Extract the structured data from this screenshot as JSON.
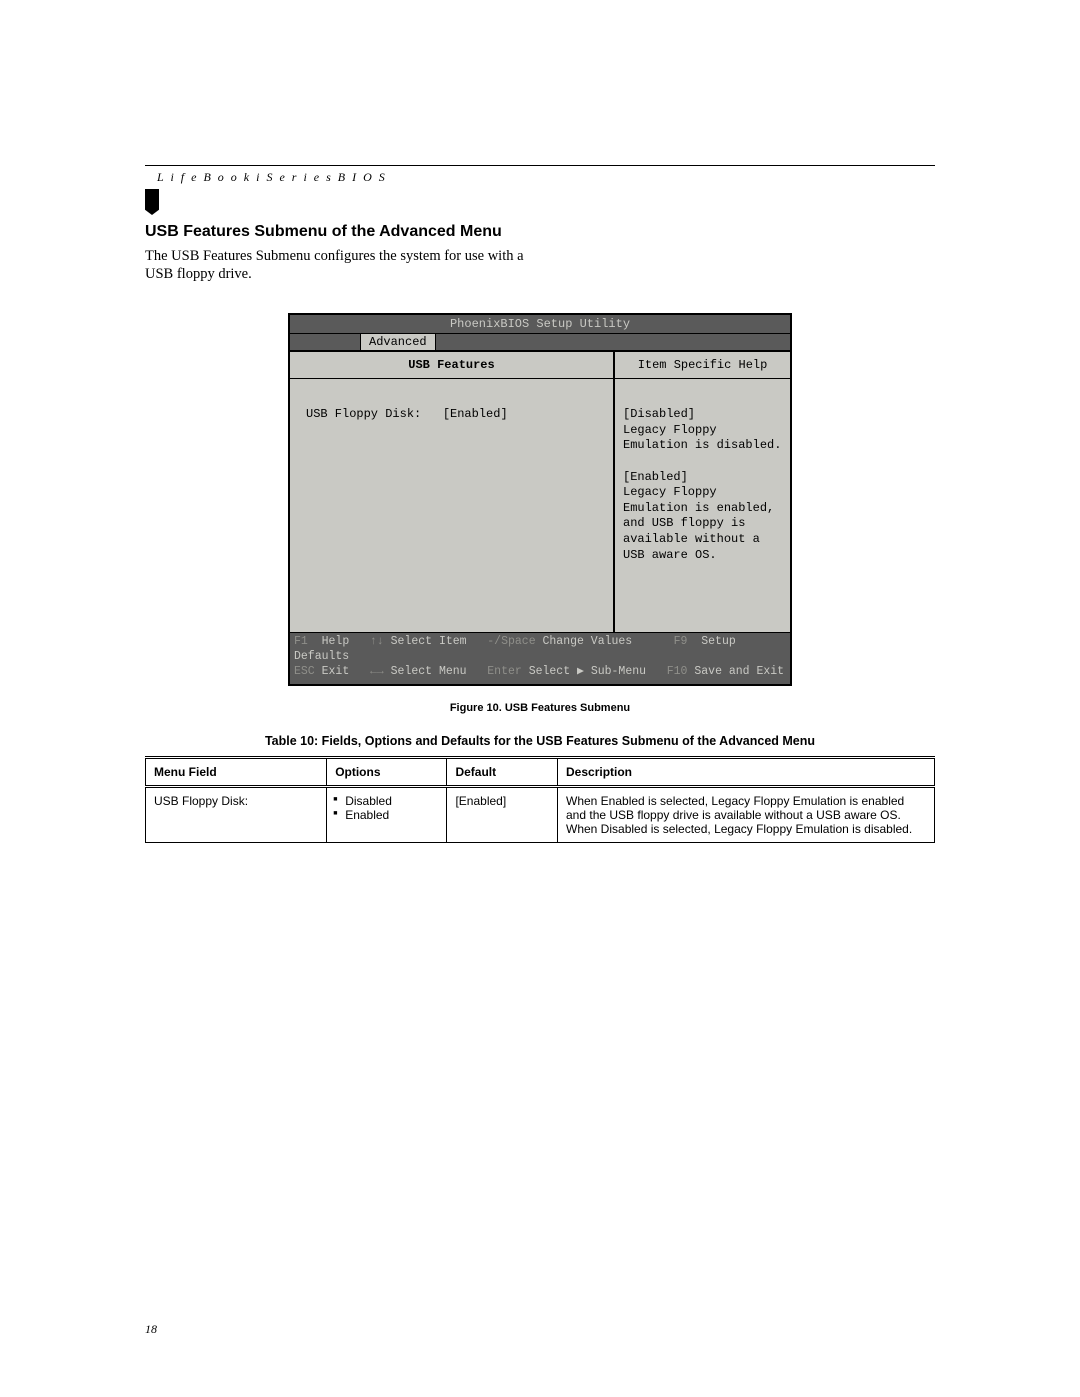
{
  "header": {
    "running": "L i f e B o o k   i   S e r i e s   B I O S"
  },
  "section": {
    "title": "USB Features Submenu of the Advanced Menu",
    "intro": "The USB Features Submenu configures the system for use with a USB floppy drive."
  },
  "bios": {
    "title": "PhoenixBIOS Setup Utility",
    "active_tab": "Advanced",
    "left_head": "USB Features",
    "right_head": "Item Specific Help",
    "field_label": "USB Floppy Disk:",
    "field_value": "[Enabled]",
    "help_line1": "[Disabled]",
    "help_line2": "Legacy Floppy Emulation is disabled.",
    "help_line3": "[Enabled]",
    "help_line4": "Legacy Floppy Emulation is enabled, and USB floppy is available without a USB aware OS.",
    "footer1": "F1  Help   ↑↓ Select Item   -/Space Change Values       F9  Setup Defaults",
    "footer2": "ESC Exit   ←→ Select Menu   Enter Select ▶ Sub-Menu    F10 Save and Exit"
  },
  "figure_caption": "Figure 10. USB Features Submenu",
  "table_caption": "Table 10: Fields, Options and Defaults for the USB Features Submenu of the Advanced Menu",
  "table": {
    "headers": {
      "c0": "Menu Field",
      "c1": "Options",
      "c2": "Default",
      "c3": "Description"
    },
    "rows": [
      {
        "menu_field": "USB Floppy Disk:",
        "option1": "Disabled",
        "option2": "Enabled",
        "default": "[Enabled]",
        "description": "When Enabled is selected, Legacy Floppy Emulation is enabled and the USB floppy drive is available without a USB aware OS. When Disabled is selected, Legacy Floppy Emulation is disabled."
      }
    ]
  },
  "page_number": "18"
}
